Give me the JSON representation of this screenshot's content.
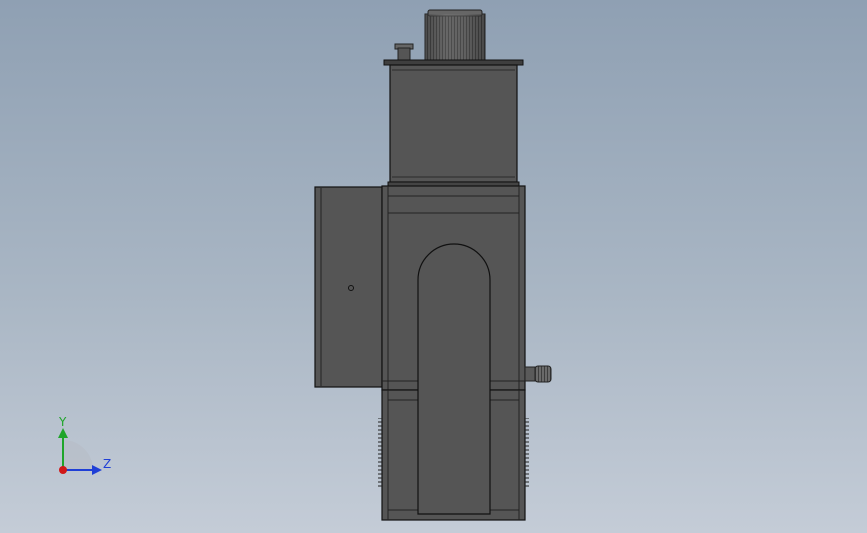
{
  "viewport": {
    "background_top": "#8fa0b3",
    "background_bottom": "#c4ccd7",
    "model_fill": "#555555",
    "model_fill_dark": "#4a4a4a",
    "edge_color": "#111111"
  },
  "triad": {
    "y_label": "Y",
    "z_label": "Z",
    "y_color": "#1fa52a",
    "z_color": "#1f3fd6",
    "x_color": "#d01818"
  },
  "parts": [
    "motor-cap",
    "nozzle",
    "top-plate",
    "upper-housing",
    "door",
    "main-housing",
    "arch-opening",
    "lower-housing",
    "side-pipe"
  ]
}
